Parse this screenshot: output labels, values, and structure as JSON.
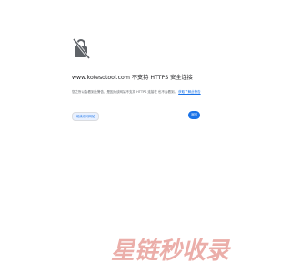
{
  "interstitial": {
    "icon": "no-https-lock-icon",
    "title": "www.kotesotool.com 不支持 HTTPS 安全连接",
    "explanation": "您之所以会看到此警告，是因为该网站不支持 HTTPS 连接在 也不会看到。",
    "learn_more_label": "获取了解此警告",
    "continue_label": "继续访问网站",
    "back_label": "返回"
  },
  "watermark": {
    "text": "星链秒收录"
  },
  "colors": {
    "primary_blue": "#1a73e8",
    "title_text": "#202124",
    "body_text": "#5f6368",
    "watermark": "#e8a09b"
  }
}
